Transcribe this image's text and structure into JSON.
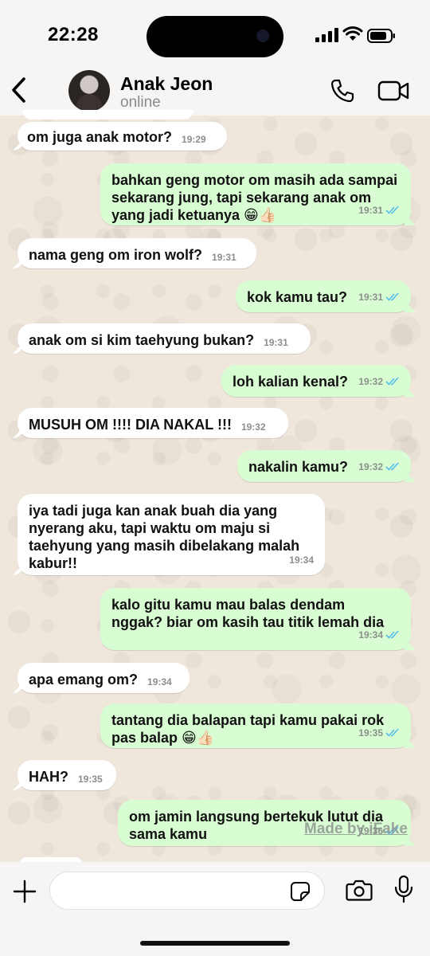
{
  "status_bar": {
    "time": "22:28"
  },
  "header": {
    "contact_name": "Anak Jeon",
    "contact_status": "online",
    "back_icon": "chevron-left-icon",
    "call_icon": "phone-icon",
    "video_icon": "video-camera-icon"
  },
  "messages": [
    {
      "dir": "in",
      "text": "om juga anak motor?",
      "time": "19:29"
    },
    {
      "dir": "out",
      "text": "bahkan geng motor om masih ada sampai sekarang jung, tapi sekarang anak om yang jadi ketuanya 😁👍🏻",
      "time": "19:31"
    },
    {
      "dir": "in",
      "text": "nama geng om iron wolf?",
      "time": "19:31"
    },
    {
      "dir": "out",
      "text": "kok kamu tau?",
      "time": "19:31"
    },
    {
      "dir": "in",
      "text": "anak om si kim taehyung bukan?",
      "time": "19:31"
    },
    {
      "dir": "out",
      "text": "loh kalian kenal?",
      "time": "19:32"
    },
    {
      "dir": "in",
      "text": "MUSUH OM !!!! DIA NAKAL !!!",
      "time": "19:32"
    },
    {
      "dir": "out",
      "text": "nakalin kamu?",
      "time": "19:32"
    },
    {
      "dir": "in",
      "text": "iya tadi juga kan anak buah dia yang nyerang aku, tapi waktu om maju si taehyung yang masih dibelakang malah kabur!!",
      "time": "19:34"
    },
    {
      "dir": "out",
      "text": "kalo gitu kamu mau balas dendam nggak? biar om kasih tau titik lemah dia",
      "time": "19:34"
    },
    {
      "dir": "in",
      "text": "apa emang om?",
      "time": "19:34"
    },
    {
      "dir": "out",
      "text": "tantang dia balapan tapi kamu pakai rok pas balap 😁👍🏻",
      "time": "19:35"
    },
    {
      "dir": "in",
      "text": "HAH?",
      "time": "19:35"
    },
    {
      "dir": "out",
      "text": "om jamin langsung bertekuk lutut dia sama kamu",
      "time": "19:36"
    }
  ],
  "watermark": "Made by iFake",
  "input_bar": {
    "placeholder": ""
  },
  "colors": {
    "outgoing_bubble": "#d9fdd3",
    "incoming_bubble": "#ffffff",
    "read_ticks": "#53bdeb"
  }
}
